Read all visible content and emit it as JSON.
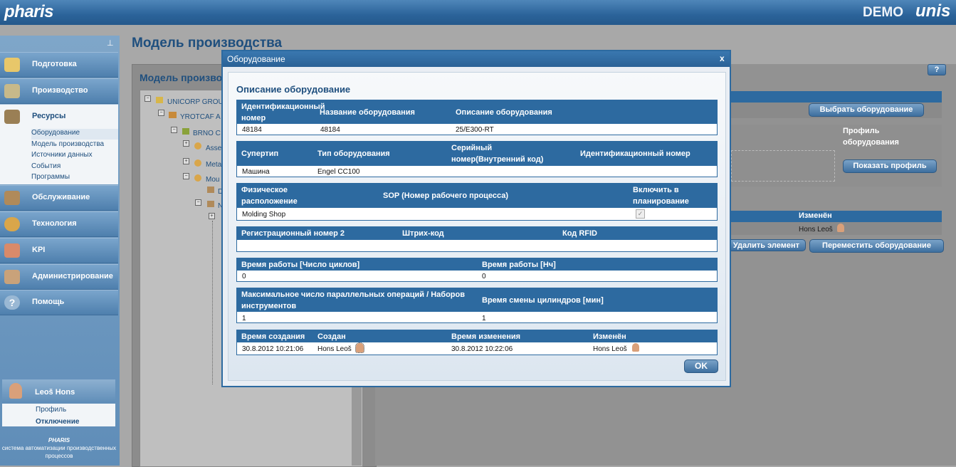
{
  "header": {
    "logo": "pharis",
    "demo_label": "DEMO",
    "brand": "unis"
  },
  "sidebar": {
    "pin_glyph": "⊥",
    "nav": [
      {
        "label": "Подготовка",
        "icon": "book-icon"
      },
      {
        "label": "Производство",
        "icon": "tools-icon"
      },
      {
        "label": "Ресурсы",
        "icon": "factory-icon"
      },
      {
        "label": "Обслуживание",
        "icon": "wrench-icon"
      },
      {
        "label": "Технология",
        "icon": "gauge-icon"
      },
      {
        "label": "KPI",
        "icon": "chart-icon"
      },
      {
        "label": "Администрирование",
        "icon": "users-icon"
      },
      {
        "label": "Помощь",
        "icon": "help-icon"
      }
    ],
    "subitems": [
      "Оборудование",
      "Модель производства",
      "Источники данных",
      "События",
      "Программы"
    ],
    "user": {
      "name": "Leoš  Hons",
      "profile": "Профиль",
      "logout": "Отключение"
    },
    "footer_logo": "PHARIS",
    "footer_text": "система автоматизации производственных процессов"
  },
  "page": {
    "title": "Модель производства"
  },
  "leftpanel": {
    "title": "Модель производ",
    "tree": [
      "UNICORP GROUP",
      "YROTCAF A",
      "BRNO C",
      "Asse",
      "Meta",
      "Mou",
      "D",
      "N"
    ]
  },
  "rightpanel": {
    "help": "?",
    "select_button": "Выбрать оборудование",
    "profile_label": "Профиль оборудования",
    "show_profile_button": "Показать профиль",
    "changed_header": "Изменён",
    "changed_value": "Hons Leoš",
    "delete_button": "Удалить элемент",
    "move_button": "Переместить оборудование"
  },
  "modal": {
    "title": "Оборудование",
    "close": "x",
    "section_title": "Описание оборудование",
    "s1": {
      "h1": "Идентификационный номер",
      "h2": "Название оборудования",
      "h3": "Описание оборудования",
      "v1": "48184",
      "v2": "48184",
      "v3": "25/E300-RT"
    },
    "s2": {
      "h1": "Супертип",
      "h2": "Тип оборудования",
      "h3": "Серийный номер(Внутренний код)",
      "h4": "Идентификационный номер",
      "v1": "Машина",
      "v2": "Engel CC100"
    },
    "s3": {
      "h1": "Физическое расположение",
      "h2": "SOP (Номер рабочего процесса)",
      "h3": "Включить в планирование",
      "v1": "Molding Shop",
      "checked": true
    },
    "s4": {
      "h1": "Регистрационный номер 2",
      "h2": "Штрих-код",
      "h3": "Код RFID"
    },
    "s5": {
      "h1": "Время работы [Число циклов]",
      "h2": "Время работы [Нч]",
      "v1": "0",
      "v2": "0"
    },
    "s6": {
      "h1": "Максимальное число параллельных операций / Наборов инструментов",
      "h2": "Время смены цилиндров [мин]",
      "v1": "1",
      "v2": "1"
    },
    "s7": {
      "h1": "Время создания",
      "h2": "Создан",
      "h3": "Время изменения",
      "h4": "Изменён",
      "v1": "30.8.2012 10:21:06",
      "v2": "Hons Leoš",
      "v3": "30.8.2012 10:22:06",
      "v4": "Hons Leoš"
    },
    "ok": "OK"
  },
  "colors": {
    "accent": "#2d6aa0",
    "header": "#2b639a"
  }
}
